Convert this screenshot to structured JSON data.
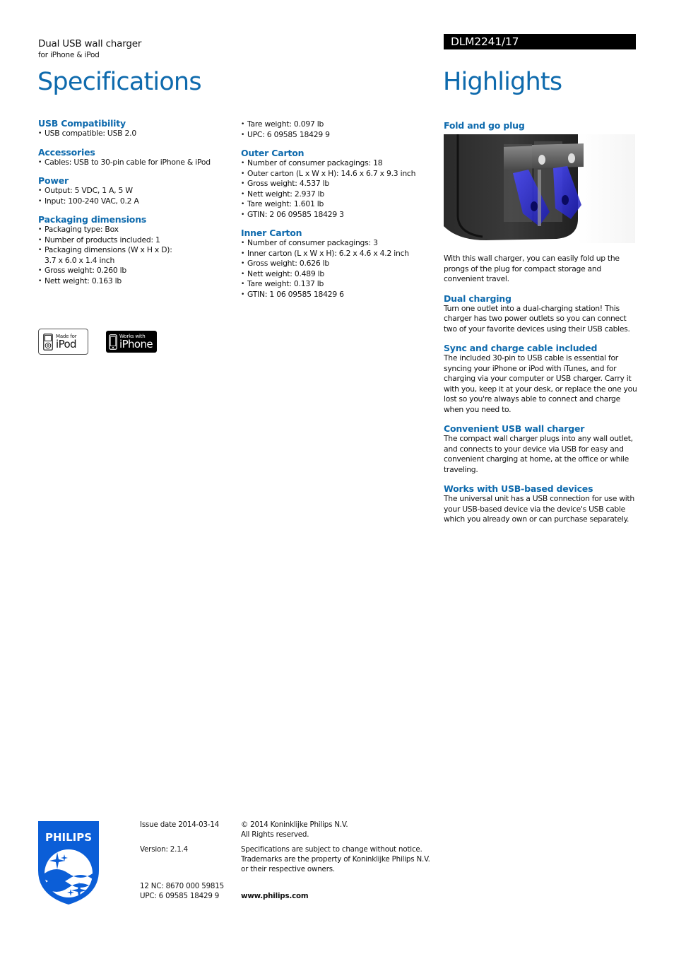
{
  "header": {
    "product_name": "Dual USB wall charger",
    "product_subtitle": "for iPhone & iPod",
    "model_number": "DLM2241/17",
    "specs_title": "Specifications",
    "highlights_title": "Highlights"
  },
  "specifications": {
    "column1": [
      {
        "heading": "USB Compatibility",
        "items": [
          "USB compatible: USB 2.0"
        ]
      },
      {
        "heading": "Accessories",
        "items": [
          "Cables: USB to 30-pin cable for iPhone & iPod"
        ]
      },
      {
        "heading": "Power",
        "items": [
          "Output: 5 VDC, 1 A, 5 W",
          "Input: 100-240 VAC, 0.2 A"
        ]
      },
      {
        "heading": "Packaging dimensions",
        "items": [
          "Packaging type: Box",
          "Number of products included: 1",
          "Packaging dimensions (W x H x D):",
          "3.7 x 6.0 x 1.4 inch",
          "Gross weight: 0.260 lb",
          "Nett weight: 0.163 lb"
        ]
      }
    ],
    "column2": [
      {
        "heading": "",
        "items": [
          "Tare weight: 0.097 lb",
          "UPC: 6 09585 18429 9"
        ]
      },
      {
        "heading": "Outer Carton",
        "items": [
          "Number of consumer packagings: 18",
          "Outer carton (L x W x H): 14.6 x 6.7 x 9.3 inch",
          "Gross weight: 4.537 lb",
          "Nett weight: 2.937 lb",
          "Tare weight: 1.601 lb",
          "GTIN: 2 06 09585 18429 3"
        ]
      },
      {
        "heading": "Inner Carton",
        "items": [
          "Number of consumer packagings: 3",
          "Inner carton (L x W x H): 6.2 x 4.6 x 4.2 inch",
          "Gross weight: 0.626 lb",
          "Nett weight: 0.489 lb",
          "Tare weight: 0.137 lb",
          "GTIN: 1 06 09585 18429 6"
        ]
      }
    ]
  },
  "badges": {
    "ipod": {
      "small": "Made for",
      "big": "iPod"
    },
    "iphone": {
      "small": "Works with",
      "big": "iPhone"
    }
  },
  "highlights": [
    {
      "heading": "Fold and go plug",
      "text": "With this wall charger, you can easily fold up the prongs of the plug for compact storage and convenient travel."
    },
    {
      "heading": "Dual charging",
      "text": "Turn one outlet into a dual-charging station! This charger has two power outlets so you can connect two of your favorite devices using their USB cables."
    },
    {
      "heading": "Sync and charge cable included",
      "text": "The included 30-pin to USB cable is essential for syncing your iPhone or iPod with iTunes, and for charging via your computer or USB charger. Carry it with you, keep it at your desk, or replace the one you lost so you're always able to connect and charge when you need to."
    },
    {
      "heading": "Convenient USB wall charger",
      "text": "The compact wall charger plugs into any wall outlet, and connects to your device via USB for easy and convenient charging at home, at the office or while traveling."
    },
    {
      "heading": "Works with USB-based devices",
      "text": "The universal unit has a USB connection for use with your USB-based device via the device's USB cable which you already own or can purchase separately."
    }
  ],
  "footer": {
    "brand": "PHILIPS",
    "issue_date": "Issue date 2014-03-14",
    "version": "Version: 2.1.4",
    "nc": "12 NC: 8670 000 59815",
    "upc": "UPC: 6 09585 18429 9",
    "copyright_line1": "© 2014 Koninklijke Philips N.V.",
    "copyright_line2": "All Rights reserved.",
    "notice_line1": "Specifications are subject to change without notice.",
    "notice_line2": "Trademarks are the property of Koninklijke Philips N.V.",
    "notice_line3": "or their respective owners.",
    "website": "www.philips.com"
  },
  "colors": {
    "accent": "#0e6aad",
    "brand_blue": "#0b5ed7",
    "model_bar": "#000000"
  }
}
